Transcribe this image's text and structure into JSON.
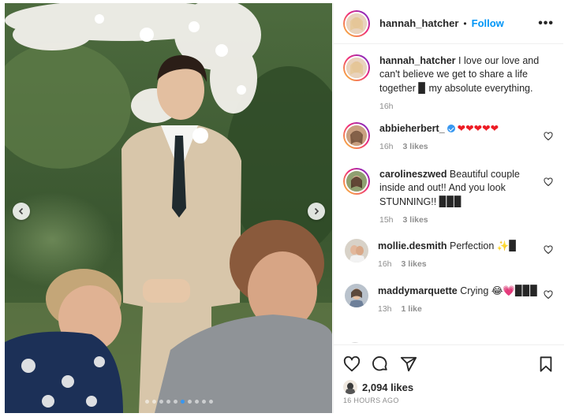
{
  "post": {
    "username": "hannah_hatcher",
    "separator": "•",
    "follow_label": "Follow",
    "more_label": "•••",
    "carousel": {
      "total_slides": 10,
      "active_slide": 6
    }
  },
  "caption": {
    "username": "hannah_hatcher",
    "text": " I love our love and can't believe we get to share a life together ",
    "emoji": "▉",
    "text_after": " my absolute everything.",
    "time": "16h"
  },
  "comments": [
    {
      "username": "abbieherbert_",
      "verified": true,
      "text": "",
      "hearts": "❤❤❤❤❤",
      "time": "16h",
      "likes": "3 likes"
    },
    {
      "username": "carolineszwed",
      "verified": false,
      "text": " Beautiful couple inside and out!! And you look STUNNING!! ",
      "emoji": "▉▉▉",
      "time": "15h",
      "likes": "3 likes"
    },
    {
      "username": "mollie.desmith",
      "verified": false,
      "text": " Perfection ",
      "emoji": "✨▉",
      "time": "16h",
      "likes": "3 likes"
    },
    {
      "username": "maddymarquette",
      "verified": false,
      "text": " Crying ",
      "emoji": "😂💗▉▉▉",
      "time": "13h",
      "likes": "1 like"
    }
  ],
  "footer": {
    "likes": "2,094 likes",
    "time_ago": "16 HOURS AGO"
  },
  "icons": {
    "heart": "heart-icon",
    "comment": "comment-icon",
    "share": "share-icon",
    "save": "bookmark-icon",
    "nav_left": "chevron-left-icon",
    "nav_right": "chevron-right-icon"
  },
  "colors": {
    "link_blue": "#0095f6",
    "verified_blue": "#3897f0",
    "meta_gray": "#8e8e8e",
    "text_dark": "#262626"
  }
}
